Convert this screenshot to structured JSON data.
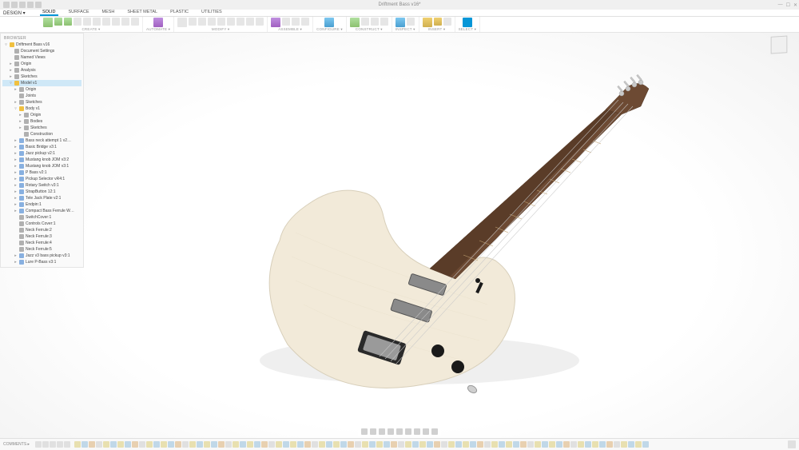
{
  "app": {
    "title": "Driftment Bass v16*"
  },
  "qat": [
    "file-new",
    "file-open",
    "save",
    "undo",
    "redo"
  ],
  "design_menu": "DESIGN ▾",
  "tabs": [
    {
      "label": "SOLID",
      "active": true
    },
    {
      "label": "SURFACE",
      "active": false
    },
    {
      "label": "MESH",
      "active": false
    },
    {
      "label": "SHEET METAL",
      "active": false
    },
    {
      "label": "PLASTIC",
      "active": false
    },
    {
      "label": "UTILITIES",
      "active": false
    }
  ],
  "toolbar_groups": [
    {
      "label": "CREATE ▾",
      "icons": [
        "new-component",
        "sketch",
        "extrude",
        "revolve",
        "sweep",
        "loft",
        "hole",
        "thread",
        "box",
        "dropdown"
      ]
    },
    {
      "label": "AUTOMATE ▾",
      "icons": [
        "automate"
      ]
    },
    {
      "label": "MODIFY ▾",
      "icons": [
        "press-pull",
        "fillet",
        "chamfer",
        "shell",
        "draft",
        "scale",
        "combine",
        "split",
        "dropdown"
      ]
    },
    {
      "label": "ASSEMBLE ▾",
      "icons": [
        "joint",
        "as-built",
        "rigid",
        "dropdown"
      ]
    },
    {
      "label": "CONFIGURE ▾",
      "icons": [
        "config"
      ]
    },
    {
      "label": "CONSTRUCT ▾",
      "icons": [
        "plane",
        "axis",
        "point",
        "dropdown"
      ]
    },
    {
      "label": "INSPECT ▾",
      "icons": [
        "measure",
        "dropdown"
      ]
    },
    {
      "label": "INSERT ▾",
      "icons": [
        "insert",
        "decal",
        "dropdown"
      ]
    },
    {
      "label": "SELECT ▾",
      "icons": [
        "select"
      ]
    }
  ],
  "browser": {
    "header": "BROWSER",
    "nodes": [
      {
        "d": 0,
        "t": "▿",
        "i": "y",
        "lbl": "Driftment Bass v16",
        "sel": false,
        "x": "◉"
      },
      {
        "d": 1,
        "t": " ",
        "i": "g",
        "lbl": "Document Settings"
      },
      {
        "d": 1,
        "t": " ",
        "i": "g",
        "lbl": "Named Views"
      },
      {
        "d": 1,
        "t": "▸",
        "i": "g",
        "lbl": "Origin"
      },
      {
        "d": 1,
        "t": "▸",
        "i": "g",
        "lbl": "Analysis"
      },
      {
        "d": 1,
        "t": "▸",
        "i": "g",
        "lbl": "Sketches"
      },
      {
        "d": 1,
        "t": "▿",
        "i": "y",
        "lbl": "Model v1",
        "sel": true
      },
      {
        "d": 2,
        "t": "▸",
        "i": "g",
        "lbl": "Origin"
      },
      {
        "d": 2,
        "t": " ",
        "i": "g",
        "lbl": "Joints"
      },
      {
        "d": 2,
        "t": "▸",
        "i": "g",
        "lbl": "Sketches"
      },
      {
        "d": 2,
        "t": "▿",
        "i": "y",
        "lbl": "Body v1"
      },
      {
        "d": 3,
        "t": "▸",
        "i": "g",
        "lbl": "Origin"
      },
      {
        "d": 3,
        "t": "▸",
        "i": "g",
        "lbl": "Bodies"
      },
      {
        "d": 3,
        "t": "▸",
        "i": "g",
        "lbl": "Sketches"
      },
      {
        "d": 3,
        "t": " ",
        "i": "g",
        "lbl": "Construction"
      },
      {
        "d": 2,
        "t": "▸",
        "i": "b",
        "lbl": "Bass neck attempt 1 v2…"
      },
      {
        "d": 2,
        "t": "▸",
        "i": "b",
        "lbl": "Basic Bridge v3:1"
      },
      {
        "d": 2,
        "t": "▸",
        "i": "b",
        "lbl": "Jazz pickup v2:1"
      },
      {
        "d": 2,
        "t": "▸",
        "i": "b",
        "lbl": "Mustang knob JOM v3:2"
      },
      {
        "d": 2,
        "t": "▸",
        "i": "b",
        "lbl": "Mustang knob JOM v3:1"
      },
      {
        "d": 2,
        "t": "▸",
        "i": "b",
        "lbl": "P Bass v2:1"
      },
      {
        "d": 2,
        "t": "▸",
        "i": "b",
        "lbl": "Pickup Selector vR4:1"
      },
      {
        "d": 2,
        "t": "▸",
        "i": "b",
        "lbl": "Rotary Switch v3:1"
      },
      {
        "d": 2,
        "t": "▸",
        "i": "b",
        "lbl": "StrapButton 12:1"
      },
      {
        "d": 2,
        "t": "▸",
        "i": "b",
        "lbl": "Tele Jack Plate v2:1"
      },
      {
        "d": 2,
        "t": "▸",
        "i": "b",
        "lbl": "Endpin:1"
      },
      {
        "d": 2,
        "t": "▸",
        "i": "b",
        "lbl": "Compact Bass Ferrule W…"
      },
      {
        "d": 2,
        "t": " ",
        "i": "g",
        "lbl": "SwitchCover:1"
      },
      {
        "d": 2,
        "t": " ",
        "i": "g",
        "lbl": "Controls Cover:1"
      },
      {
        "d": 2,
        "t": " ",
        "i": "g",
        "lbl": "Neck Ferrule:2"
      },
      {
        "d": 2,
        "t": " ",
        "i": "g",
        "lbl": "Neck Ferrule:3"
      },
      {
        "d": 2,
        "t": " ",
        "i": "g",
        "lbl": "Neck Ferrule:4"
      },
      {
        "d": 2,
        "t": " ",
        "i": "g",
        "lbl": "Neck Ferrule:5"
      },
      {
        "d": 2,
        "t": "▸",
        "i": "b",
        "lbl": "Jazz v3 bass pickup v3:1"
      },
      {
        "d": 2,
        "t": "▸",
        "i": "b",
        "lbl": "Lure P-Bass v3:1"
      }
    ]
  },
  "navbar": [
    "orbit",
    "pan",
    "zoom",
    "fit",
    "look",
    "display",
    "grid",
    "viewports",
    "fx"
  ],
  "viewcube": "HOME",
  "timeline": {
    "comments": "COMMENTS ▸",
    "play": [
      "to-start",
      "step-back",
      "play",
      "step-fwd",
      "to-end"
    ],
    "features": 80,
    "options": "⚙"
  }
}
